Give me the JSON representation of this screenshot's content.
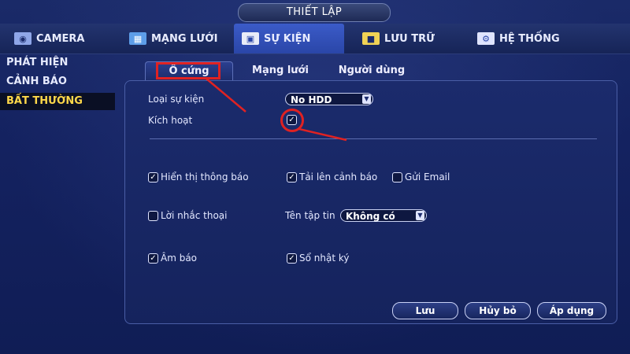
{
  "title": "THIẾT LẬP",
  "top_tabs": [
    {
      "label": "CAMERA",
      "icon": "camera-icon"
    },
    {
      "label": "MẠNG LƯỚI",
      "icon": "network-icon"
    },
    {
      "label": "SỰ KIỆN",
      "icon": "event-icon"
    },
    {
      "label": "LƯU TRỮ",
      "icon": "storage-icon"
    },
    {
      "label": "HỆ THỐNG",
      "icon": "system-icon"
    }
  ],
  "sidebar": {
    "items": [
      "PHÁT HIỆN",
      "CẢNH BÁO",
      "BẤT THƯỜNG"
    ]
  },
  "sub_tabs": [
    "Ổ cứng",
    "Mạng lưới",
    "Người dùng"
  ],
  "form": {
    "event_type_label": "Loại sự kiện",
    "event_type_value": "No HDD",
    "enable_label": "Kích hoạt",
    "show_message_label": "Hiển thị thông báo",
    "alarm_upload_label": "Tải lên cảnh báo",
    "send_email_label": "Gửi Email",
    "voice_prompt_label": "Lời nhắc thoại",
    "file_name_label": "Tên tập tin",
    "file_name_value": "Không có",
    "buzzer_label": "Âm báo",
    "log_label": "Sổ nhật ký"
  },
  "checkboxes": {
    "enable": true,
    "show_message": true,
    "alarm_upload": true,
    "send_email": false,
    "voice_prompt": false,
    "buzzer": true,
    "log": true
  },
  "buttons": {
    "save": "Lưu",
    "cancel": "Hủy bỏ",
    "apply": "Áp dụng"
  },
  "colors": {
    "background": "#142260",
    "active_tab": "#3b5bc8",
    "highlight": "#ffd84a",
    "annotation": "#e02222"
  }
}
